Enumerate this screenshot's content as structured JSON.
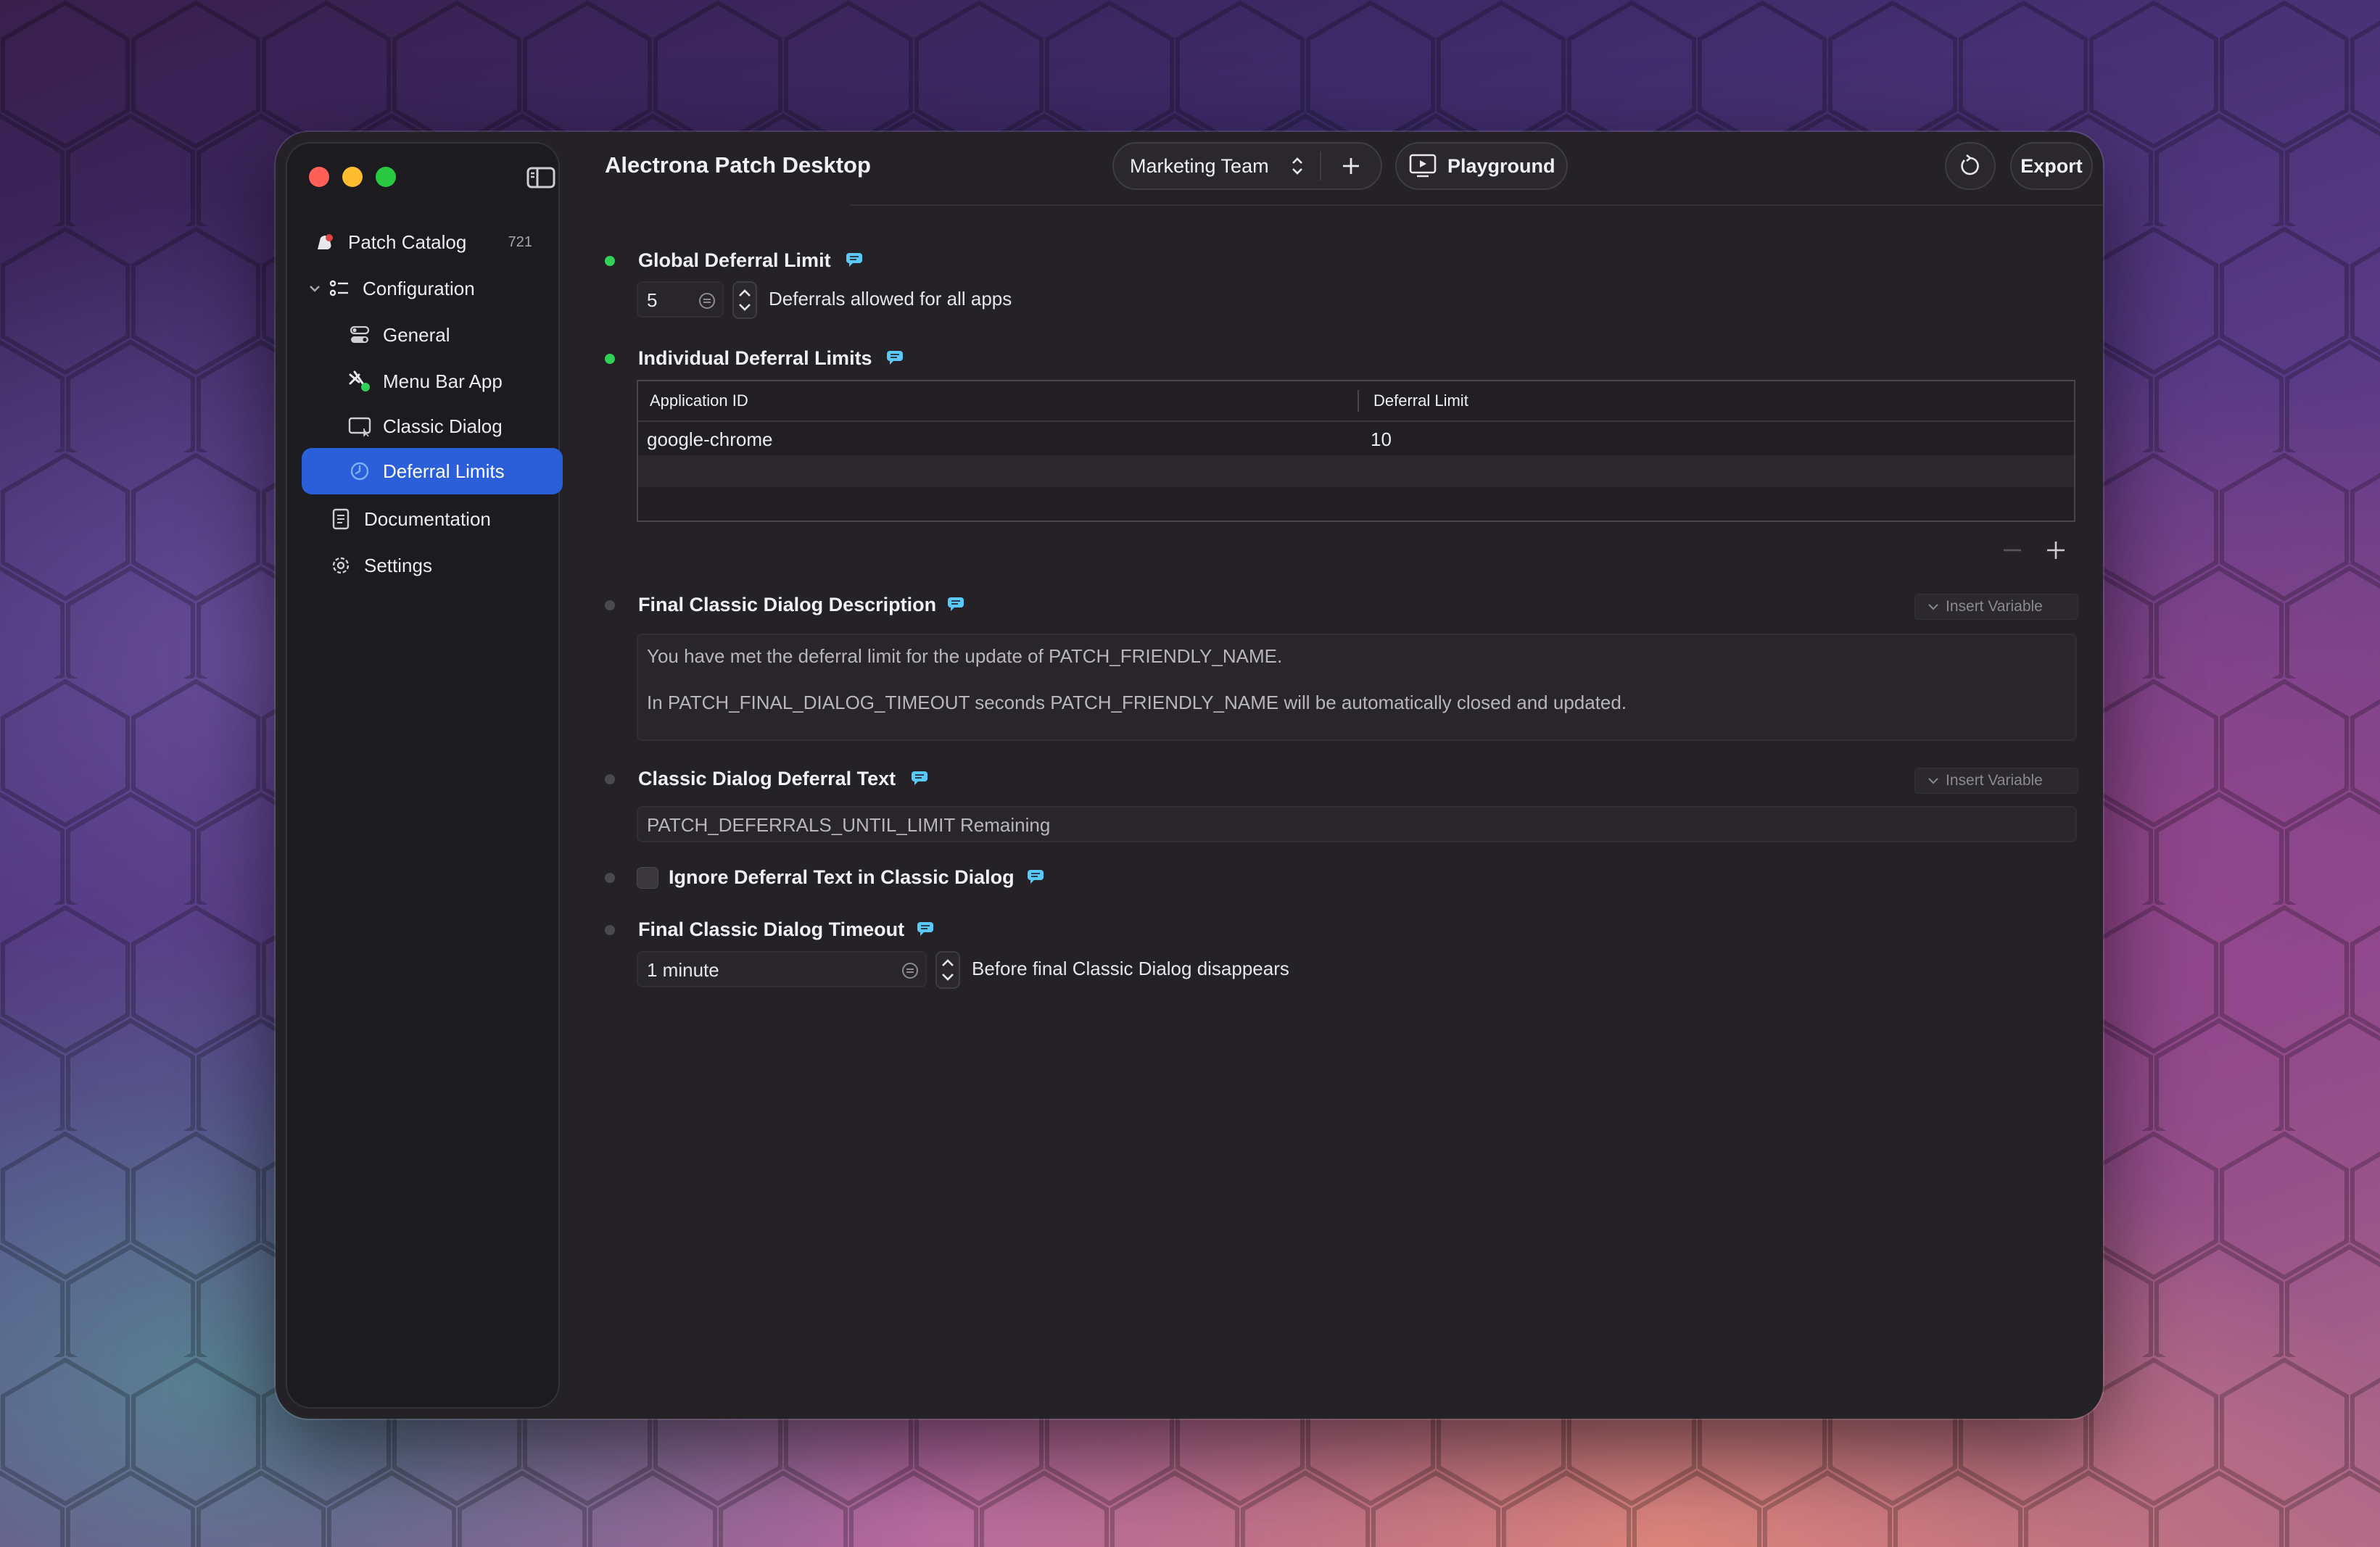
{
  "window": {
    "title": "Alectrona Patch Desktop"
  },
  "toolbar": {
    "team_selector": "Marketing Team",
    "playground_label": "Playground",
    "export_label": "Export"
  },
  "sidebar": {
    "items": [
      {
        "label": "Patch Catalog",
        "count": "721",
        "icon": "patch-catalog-icon"
      },
      {
        "label": "Configuration",
        "icon": "list-settings-icon"
      },
      {
        "label": "General",
        "icon": "toggles-icon"
      },
      {
        "label": "Menu Bar App",
        "icon": "menu-bar-app-icon"
      },
      {
        "label": "Classic Dialog",
        "icon": "dialog-window-icon"
      },
      {
        "label": "Deferral Limits",
        "icon": "clock-icon",
        "selected": true
      },
      {
        "label": "Documentation",
        "icon": "document-icon"
      },
      {
        "label": "Settings",
        "icon": "gear-icon"
      }
    ]
  },
  "settings": {
    "global_deferral": {
      "label": "Global Deferral Limit",
      "value": "5",
      "description": "Deferrals allowed for all apps"
    },
    "individual_deferrals": {
      "label": "Individual Deferral Limits",
      "columns": [
        "Application ID",
        "Deferral Limit"
      ],
      "rows": [
        {
          "app_id": "google-chrome",
          "limit": "10"
        }
      ]
    },
    "final_dialog_description": {
      "label": "Final Classic Dialog Description",
      "insert_variable": "Insert Variable",
      "line1": "You have met the deferral limit for the update of PATCH_FRIENDLY_NAME.",
      "line2": "In PATCH_FINAL_DIALOG_TIMEOUT seconds PATCH_FRIENDLY_NAME will be automatically closed and updated."
    },
    "deferral_text": {
      "label": "Classic Dialog Deferral Text",
      "insert_variable": "Insert Variable",
      "value": "PATCH_DEFERRALS_UNTIL_LIMIT Remaining"
    },
    "ignore_deferral_text": {
      "label": "Ignore Deferral Text in Classic Dialog",
      "checked": false
    },
    "final_dialog_timeout": {
      "label": "Final Classic Dialog Timeout",
      "value": "1 minute",
      "description": "Before final Classic Dialog disappears"
    }
  },
  "colors": {
    "accent": "#2b5fd9",
    "status_on": "#30d158",
    "comment_icon": "#5ac8fa"
  }
}
